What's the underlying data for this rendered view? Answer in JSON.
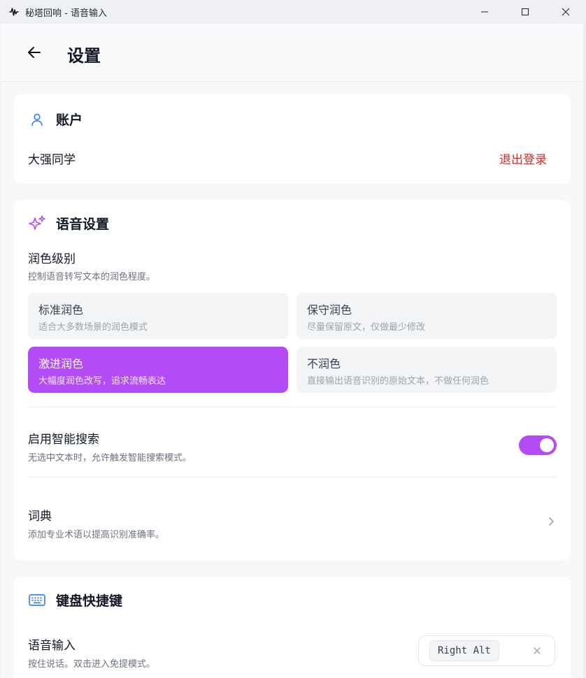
{
  "window": {
    "title": "秘塔回响 - 语音输入"
  },
  "header": {
    "title": "设置"
  },
  "account": {
    "heading": "账户",
    "username": "大强同学",
    "logout_label": "退出登录"
  },
  "voice": {
    "heading": "语音设置",
    "polish_title": "润色级别",
    "polish_desc": "控制语音转写文本的润色程度。",
    "options": [
      {
        "title": "标准润色",
        "desc": "适合大多数场景的润色模式",
        "selected": false
      },
      {
        "title": "保守润色",
        "desc": "尽量保留原文，仅做最少修改",
        "selected": false
      },
      {
        "title": "激进润色",
        "desc": "大幅度润色改写，追求流畅表达",
        "selected": true
      },
      {
        "title": "不润色",
        "desc": "直接输出语音识别的原始文本，不做任何润色",
        "selected": false
      }
    ],
    "smart_search_title": "启用智能搜索",
    "smart_search_desc": "无选中文本时，允许触发智能搜索模式。",
    "smart_search_enabled": true,
    "dictionary_title": "词典",
    "dictionary_desc": "添加专业术语以提高识别准确率。"
  },
  "keyboard": {
    "heading": "键盘快捷键",
    "voice_input_title": "语音输入",
    "voice_input_desc": "按住说话。双击进入免提模式。",
    "voice_input_key": "Right Alt"
  },
  "colors": {
    "accent": "#b44cf5",
    "danger": "#dc2626",
    "account_icon": "#3b82f6",
    "keyboard_icon": "#3b82f6"
  },
  "icons": {
    "app": "waveform-icon",
    "back": "arrow-left-icon",
    "account": "user-icon",
    "voice": "sparkles-icon",
    "keyboard": "keyboard-icon",
    "dictionary_chevron": "chevron-right-icon",
    "clear": "close-icon"
  }
}
